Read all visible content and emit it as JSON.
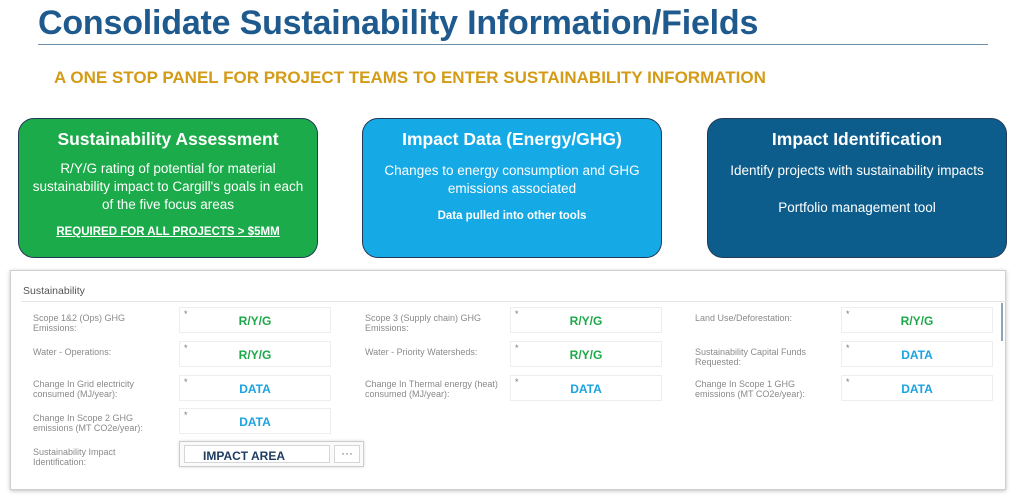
{
  "header": {
    "title": "Consolidate Sustainability Information/Fields",
    "subtitle": "A ONE STOP PANEL FOR PROJECT TEAMS TO ENTER SUSTAINABILITY INFORMATION"
  },
  "cards": [
    {
      "title": "Sustainability Assessment",
      "body": "R/Y/G rating of potential for material sustainability impact to Cargill's goals in each of the five focus areas",
      "note": "REQUIRED FOR ALL PROJECTS > $5MM",
      "color": "#1cab4a"
    },
    {
      "title": "Impact Data (Energy/GHG)",
      "body": "Changes to energy consumption and GHG emissions associated",
      "note": "Data pulled into other tools",
      "color": "#15a9e6"
    },
    {
      "title": "Impact Identification",
      "body": "Identify projects with sustainability impacts",
      "body2": "Portfolio management tool",
      "color": "#0d5d8c"
    }
  ],
  "panel": {
    "title": "Sustainability",
    "fields": [
      {
        "label": "Scope 1&2 (Ops) GHG Emissions:",
        "required": "*",
        "value": "R/Y/G"
      },
      {
        "label": "Scope 3 (Supply chain) GHG Emissions:",
        "required": "*",
        "value": "R/Y/G"
      },
      {
        "label": "Land Use/Deforestation:",
        "required": "*",
        "value": "R/Y/G"
      },
      {
        "label": "Water - Operations:",
        "required": "*",
        "value": "R/Y/G"
      },
      {
        "label": "Water - Priority Watersheds:",
        "required": "*",
        "value": "R/Y/G"
      },
      {
        "label": "Sustainability Capital Funds Requested:",
        "required": "*",
        "value": "DATA"
      },
      {
        "label": "Change In Grid electricity consumed (MJ/year):",
        "required": "*",
        "value": "DATA"
      },
      {
        "label": "Change In Thermal energy (heat) consumed (MJ/year):",
        "required": "*",
        "value": "DATA"
      },
      {
        "label": "Change In Scope 1 GHG emissions (MT CO2e/year):",
        "required": "*",
        "value": "DATA"
      },
      {
        "label": "Change In Scope 2 GHG emissions (MT CO2e/year):",
        "required": "*",
        "value": "DATA"
      }
    ],
    "impact": {
      "label": "Sustainability Impact Identification:",
      "value": "IMPACT AREA",
      "more": "···"
    }
  },
  "colors": {
    "ryg": "#1fa84a",
    "data": "#1aa3e0",
    "title": "#1f5a8e",
    "subtitle": "#d39b16"
  }
}
